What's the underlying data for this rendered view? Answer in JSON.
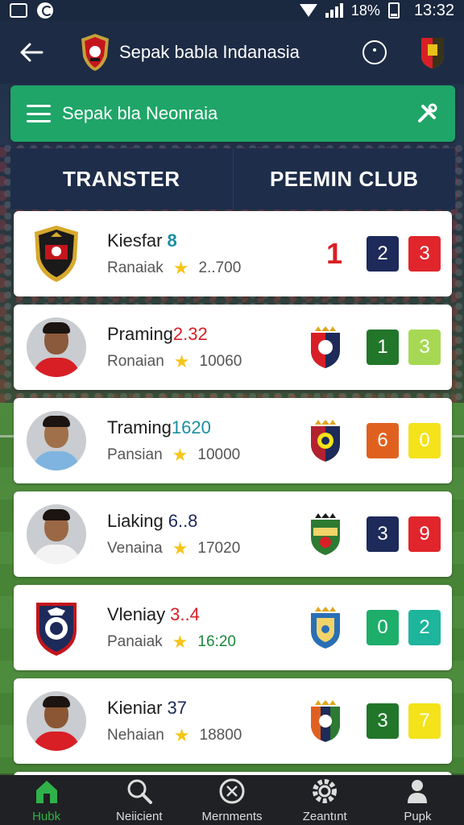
{
  "status_bar": {
    "battery": "18%",
    "time": "13:32"
  },
  "app_bar": {
    "title": "Sepak babla Indanasia"
  },
  "search": {
    "text": "Sepak bla Neonraia"
  },
  "tabs": [
    {
      "label": "TRANSTER"
    },
    {
      "label": "PEEMIN CLUB"
    }
  ],
  "rows": [
    {
      "name": "Kiesfar",
      "value": "8",
      "value_color": "#1a8fa0",
      "sub": "Ranaiak",
      "rating": "2..700",
      "rating_color": "#555555",
      "avatar": "crest-red",
      "big_score": "1",
      "scores": [
        {
          "v": "2",
          "c": "#1d2a5a"
        },
        {
          "v": "3",
          "c": "#e0262c"
        }
      ]
    },
    {
      "name": "Praming",
      "value": "2.32",
      "value_color": "#d81f26",
      "sub": "Ronaian",
      "rating": "10060",
      "rating_color": "#555555",
      "avatar": "photo-red",
      "crest": "crest-blue-red",
      "scores": [
        {
          "v": "1",
          "c": "#22762a"
        },
        {
          "v": "3",
          "c": "#a6d854"
        }
      ]
    },
    {
      "name": "Traming",
      "value": "1620",
      "value_color": "#1a8fa0",
      "sub": "Pansian",
      "rating": "10000",
      "rating_color": "#555555",
      "avatar": "photo-blue",
      "crest": "crest-navy",
      "scores": [
        {
          "v": "6",
          "c": "#e0611f"
        },
        {
          "v": "0",
          "c": "#f4e21a"
        }
      ]
    },
    {
      "name": "Liaking",
      "value": "6..8",
      "value_color": "#1d2a5a",
      "sub": "Venaina",
      "rating": "17020",
      "rating_color": "#555555",
      "avatar": "photo-white",
      "crest": "crest-green",
      "scores": [
        {
          "v": "3",
          "c": "#1d2a5a"
        },
        {
          "v": "9",
          "c": "#e0262c"
        }
      ]
    },
    {
      "name": "Vleniay",
      "value": "3..4",
      "value_color": "#d81f26",
      "sub": "Panaiak",
      "rating": "16:20",
      "rating_color": "#1a8a3a",
      "avatar": "crest-navy-red",
      "crest": "crest-gold-blue",
      "scores": [
        {
          "v": "0",
          "c": "#1dae6a"
        },
        {
          "v": "2",
          "c": "#1db59c"
        }
      ]
    },
    {
      "name": "Kieniar",
      "value": "37",
      "value_color": "#1d2a5a",
      "sub": "Nehaian",
      "rating": "18800",
      "rating_color": "#555555",
      "avatar": "photo-red",
      "crest": "crest-tricolor",
      "scores": [
        {
          "v": "3",
          "c": "#22762a"
        },
        {
          "v": "7",
          "c": "#f4e21a"
        }
      ]
    }
  ],
  "nav": [
    {
      "label": "Hubk",
      "icon": "home-icon",
      "active": true
    },
    {
      "label": "Neiicient",
      "icon": "search-icon",
      "active": false
    },
    {
      "label": "Mernments",
      "icon": "clock-icon",
      "active": false
    },
    {
      "label": "Zeantınt",
      "icon": "gear-icon",
      "active": false
    },
    {
      "label": "Pupk",
      "icon": "person-icon",
      "active": false
    }
  ]
}
